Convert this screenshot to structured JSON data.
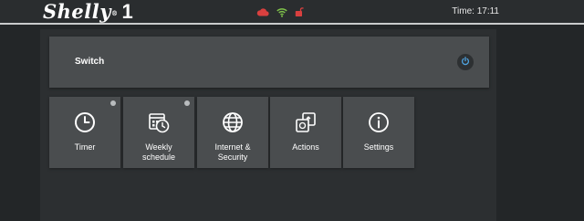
{
  "header": {
    "brand": "Shelly",
    "model": "1",
    "registered_mark": "®",
    "time_label": "Time: 17:11",
    "icons": [
      "cloud-icon",
      "wifi-icon",
      "lock-icon"
    ],
    "colors": {
      "cloud": "#d9403f",
      "wifi": "#7fc24a",
      "lock": "#d9403f"
    }
  },
  "switch": {
    "label": "Switch",
    "state_icon": "power-icon"
  },
  "tiles": [
    {
      "id": "timer",
      "label": "Timer",
      "icon": "clock-icon",
      "indicator": true
    },
    {
      "id": "weekly-schedule",
      "label": "Weekly\nschedule",
      "icon": "calendar-icon",
      "indicator": true
    },
    {
      "id": "internet-security",
      "label": "Internet &\nSecurity",
      "icon": "globe-icon",
      "indicator": false
    },
    {
      "id": "actions",
      "label": "Actions",
      "icon": "actions-icon",
      "indicator": false
    },
    {
      "id": "settings",
      "label": "Settings",
      "icon": "info-icon",
      "indicator": false
    }
  ]
}
